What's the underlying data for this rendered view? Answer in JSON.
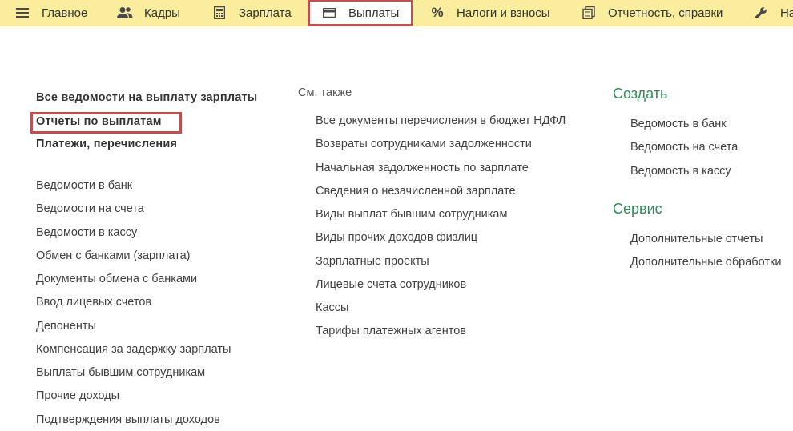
{
  "menu": {
    "tabs": [
      {
        "label": "Главное",
        "icon": "hamburger-menu-icon"
      },
      {
        "label": "Кадры",
        "icon": "people-icon"
      },
      {
        "label": "Зарплата",
        "icon": "calculator-icon"
      },
      {
        "label": "Выплаты",
        "icon": "wallet-card-icon",
        "active": true
      },
      {
        "label": "Налоги и взносы",
        "icon": "percent-icon"
      },
      {
        "label": "Отчетность, справки",
        "icon": "documents-icon"
      },
      {
        "label": "На",
        "icon": "wrench-icon"
      }
    ]
  },
  "left": {
    "bold_items": [
      "Все ведомости на выплату зарплаты",
      "Отчеты по выплатам",
      "Платежи, перечисления"
    ],
    "items": [
      "Ведомости в банк",
      "Ведомости на счета",
      "Ведомости в кассу",
      "Обмен с банками (зарплата)",
      "Документы обмена с банками",
      "Ввод лицевых счетов",
      "Депоненты",
      "Компенсация за задержку зарплаты",
      "Выплаты бывшим сотрудникам",
      "Прочие доходы",
      "Подтверждения выплаты доходов"
    ]
  },
  "middle": {
    "title": "См. также",
    "items": [
      "Все документы перечисления в бюджет НДФЛ",
      "Возвраты сотрудниками задолженности",
      "Начальная задолженность по зарплате",
      "Сведения о незачисленной зарплате",
      "Виды выплат бывшим сотрудникам",
      "Виды прочих доходов физлиц",
      "Зарплатные проекты",
      "Лицевые счета сотрудников",
      "Кассы",
      "Тарифы платежных агентов"
    ]
  },
  "right": {
    "create_title": "Создать",
    "create_items": [
      "Ведомость в банк",
      "Ведомость на счета",
      "Ведомость в кассу"
    ],
    "service_title": "Сервис",
    "service_items": [
      "Дополнительные отчеты",
      "Дополнительные обработки"
    ]
  },
  "colors": {
    "menu_bg": "#fbed9e",
    "highlight": "#c0504d",
    "section_green": "#2e8b57"
  }
}
